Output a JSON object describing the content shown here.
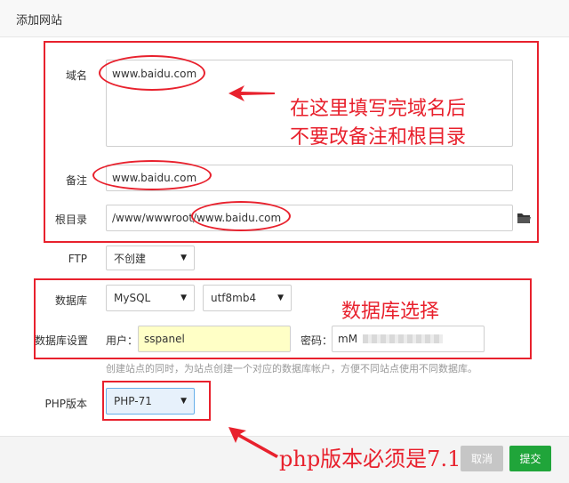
{
  "dialog": {
    "title": "添加网站"
  },
  "form": {
    "domain_label": "域名",
    "domain_value": "www.baidu.com",
    "remark_label": "备注",
    "remark_value": "www.baidu.com",
    "root_label": "根目录",
    "root_prefix": "/www/wwwroot/",
    "root_suffix": "www.baidu.com",
    "ftp_label": "FTP",
    "ftp_value": "不创建",
    "db_label": "数据库",
    "db_type": "MySQL",
    "db_charset": "utf8mb4",
    "db_settings_label": "数据库设置",
    "db_user_label": "用户：",
    "db_user_value": "sspanel",
    "db_pass_label": "密码：",
    "db_pass_value": "mM",
    "db_help": "创建站点的同时，为站点创建一个对应的数据库帐户，方便不同站点使用不同数据库。",
    "php_label": "PHP版本",
    "php_value": "PHP-71"
  },
  "annotations": {
    "note1_line1": "在这里填写完域名后",
    "note1_line2": "不要改备注和根目录",
    "note2": "数据库选择",
    "note3": "php版本必须是7.1"
  },
  "footer": {
    "cancel_label": "取消",
    "submit_label": "提交"
  },
  "icons": {
    "folder": "folder-icon",
    "arrow": "arrow-icon"
  },
  "colors": {
    "annotation_red": "#e8212d",
    "submit_green": "#20a53a",
    "php_highlight": "#e7f1fb"
  }
}
